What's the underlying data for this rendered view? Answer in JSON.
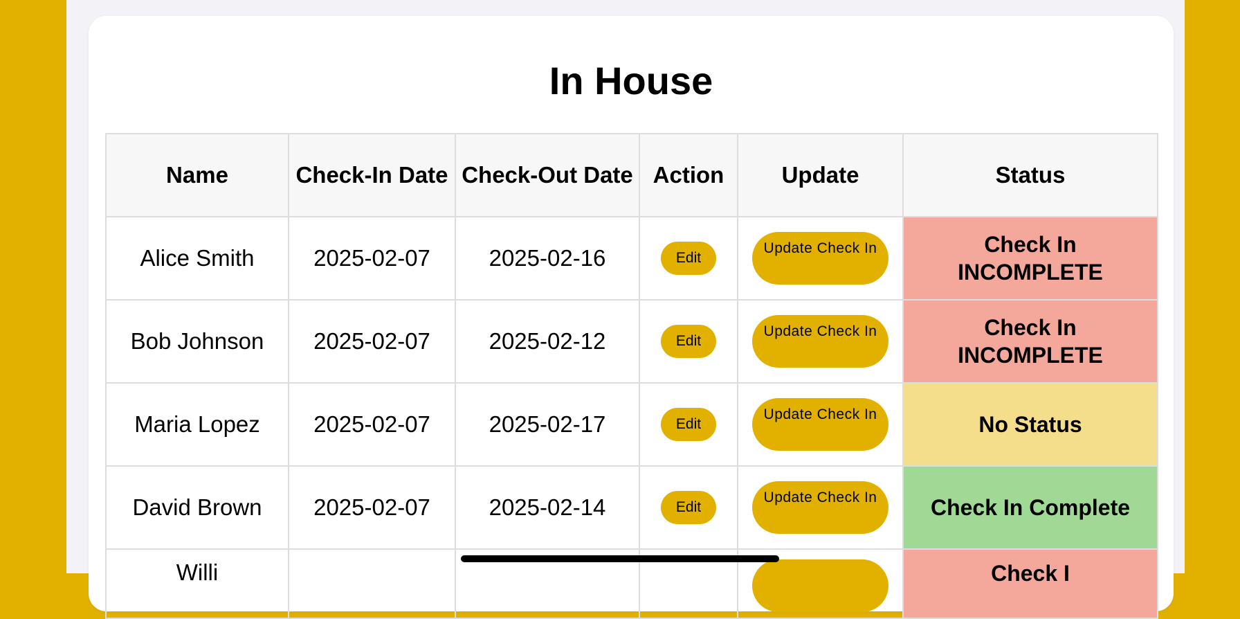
{
  "page": {
    "title": "In House"
  },
  "colors": {
    "accent": "#e2b100",
    "incomplete": "#f4a89c",
    "no_status": "#f5de8b",
    "complete": "#a0d996"
  },
  "table": {
    "headers": {
      "name": "Name",
      "check_in": "Check-In Date",
      "check_out": "Check-Out Date",
      "action": "Action",
      "update": "Update",
      "status": "Status"
    },
    "rows": [
      {
        "name": "Alice Smith",
        "check_in": "2025-02-07",
        "check_out": "2025-02-16",
        "action": "Edit",
        "update": "Update Check In",
        "status": "Check In INCOMPLETE"
      },
      {
        "name": "Bob Johnson",
        "check_in": "2025-02-07",
        "check_out": "2025-02-12",
        "action": "Edit",
        "update": "Update Check In",
        "status": "Check In INCOMPLETE"
      },
      {
        "name": "Maria Lopez",
        "check_in": "2025-02-07",
        "check_out": "2025-02-17",
        "action": "Edit",
        "update": "Update Check In",
        "status": "No Status"
      },
      {
        "name": "David Brown",
        "check_in": "2025-02-07",
        "check_out": "2025-02-14",
        "action": "Edit",
        "update": "Update Check In",
        "status": "Check In Complete"
      }
    ],
    "partial_row": {
      "name": "Willi",
      "status": "Check I"
    }
  }
}
